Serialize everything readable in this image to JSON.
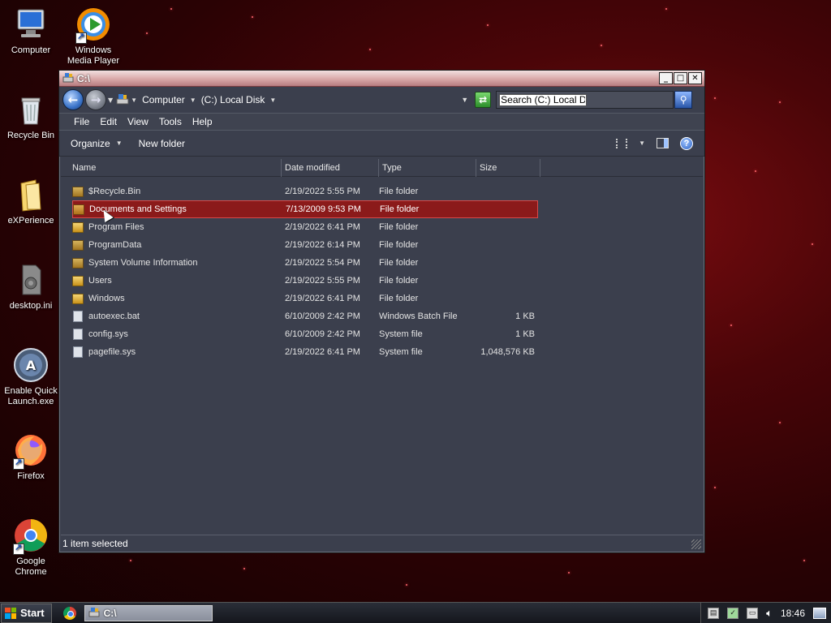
{
  "desktop": {
    "icons": [
      {
        "label": "Computer"
      },
      {
        "label": "Windows Media Player"
      },
      {
        "label": "Recycle Bin"
      },
      {
        "label": "eXPerience"
      },
      {
        "label": "desktop.ini"
      },
      {
        "label": "Enable Quick Launch.exe"
      },
      {
        "label": "Firefox"
      },
      {
        "label": "Google Chrome"
      }
    ]
  },
  "window": {
    "title": "C:\\",
    "address": {
      "crumbs": [
        "Computer",
        "(C:) Local Disk"
      ]
    },
    "search": {
      "value": "Search (C:) Local Disk"
    },
    "menu": [
      "File",
      "Edit",
      "View",
      "Tools",
      "Help"
    ],
    "commands": {
      "organize": "Organize",
      "new_folder": "New folder"
    },
    "columns": [
      "Name",
      "Date modified",
      "Type",
      "Size"
    ],
    "files": [
      {
        "name": "$Recycle.Bin",
        "date": "2/19/2022 5:55 PM",
        "type": "File folder",
        "size": "",
        "icon": "folder-icon"
      },
      {
        "name": "Documents and Settings",
        "date": "7/13/2009 9:53 PM",
        "type": "File folder",
        "size": "",
        "icon": "folder-icon",
        "selected": true
      },
      {
        "name": "Program Files",
        "date": "2/19/2022 6:41 PM",
        "type": "File folder",
        "size": "",
        "icon": "folder-icon"
      },
      {
        "name": "ProgramData",
        "date": "2/19/2022 6:14 PM",
        "type": "File folder",
        "size": "",
        "icon": "folder-icon"
      },
      {
        "name": "System Volume Information",
        "date": "2/19/2022 5:54 PM",
        "type": "File folder",
        "size": "",
        "icon": "folder-icon"
      },
      {
        "name": "Users",
        "date": "2/19/2022 5:55 PM",
        "type": "File folder",
        "size": "",
        "icon": "folder-icon"
      },
      {
        "name": "Windows",
        "date": "2/19/2022 6:41 PM",
        "type": "File folder",
        "size": "",
        "icon": "folder-icon"
      },
      {
        "name": "autoexec.bat",
        "date": "6/10/2009 2:42 PM",
        "type": "Windows Batch File",
        "size": "1 KB",
        "icon": "file-icon"
      },
      {
        "name": "config.sys",
        "date": "6/10/2009 2:42 PM",
        "type": "System file",
        "size": "1 KB",
        "icon": "file-icon"
      },
      {
        "name": "pagefile.sys",
        "date": "2/19/2022 6:41 PM",
        "type": "System file",
        "size": "1,048,576 KB",
        "icon": "file-icon"
      }
    ],
    "status": "1 item selected"
  },
  "taskbar": {
    "start_label": "Start",
    "task_label": "C:\\",
    "clock": "18:46"
  },
  "colors": {
    "selection": "#8b1a1a",
    "window_bg": "#3b3f4d",
    "desktop": "#4a0508"
  }
}
